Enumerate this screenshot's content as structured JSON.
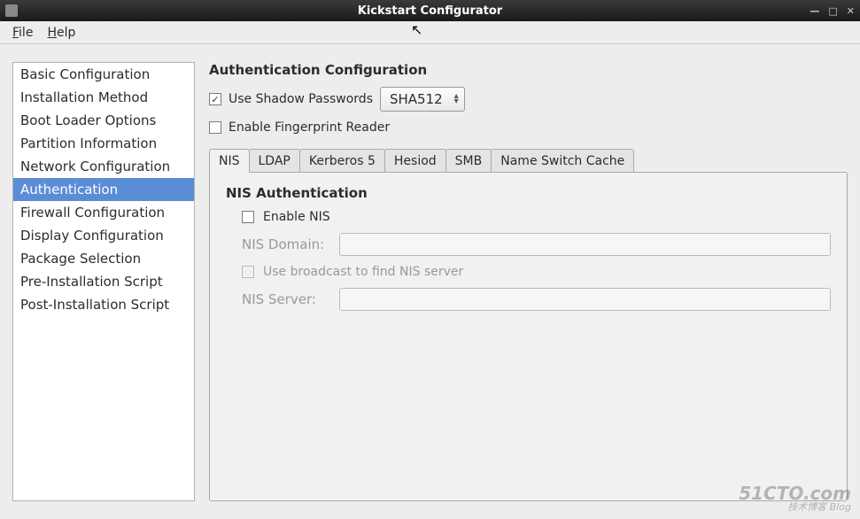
{
  "window": {
    "title": "Kickstart Configurator"
  },
  "menubar": {
    "file": "File",
    "help": "Help"
  },
  "sidebar": {
    "items": [
      {
        "label": "Basic Configuration",
        "active": false
      },
      {
        "label": "Installation Method",
        "active": false
      },
      {
        "label": "Boot Loader Options",
        "active": false
      },
      {
        "label": "Partition Information",
        "active": false
      },
      {
        "label": "Network Configuration",
        "active": false
      },
      {
        "label": "Authentication",
        "active": true
      },
      {
        "label": "Firewall Configuration",
        "active": false
      },
      {
        "label": "Display Configuration",
        "active": false
      },
      {
        "label": "Package Selection",
        "active": false
      },
      {
        "label": "Pre-Installation Script",
        "active": false
      },
      {
        "label": "Post-Installation Script",
        "active": false
      }
    ]
  },
  "main": {
    "title": "Authentication Configuration",
    "use_shadow_label": "Use Shadow Passwords",
    "use_shadow_checked": true,
    "hash_algo": "SHA512",
    "enable_fingerprint_label": "Enable Fingerprint Reader",
    "enable_fingerprint_checked": false,
    "tabs": [
      {
        "label": "NIS",
        "active": true
      },
      {
        "label": "LDAP",
        "active": false
      },
      {
        "label": "Kerberos 5",
        "active": false
      },
      {
        "label": "Hesiod",
        "active": false
      },
      {
        "label": "SMB",
        "active": false
      },
      {
        "label": "Name Switch Cache",
        "active": false
      }
    ],
    "nis": {
      "section_title": "NIS Authentication",
      "enable_label": "Enable NIS",
      "enable_checked": false,
      "domain_label": "NIS Domain:",
      "domain_value": "",
      "broadcast_label": "Use broadcast to find NIS server",
      "broadcast_checked": false,
      "server_label": "NIS Server:",
      "server_value": ""
    }
  },
  "watermark": {
    "main": "51CTO.com",
    "sub": "技术博客  Blog"
  }
}
